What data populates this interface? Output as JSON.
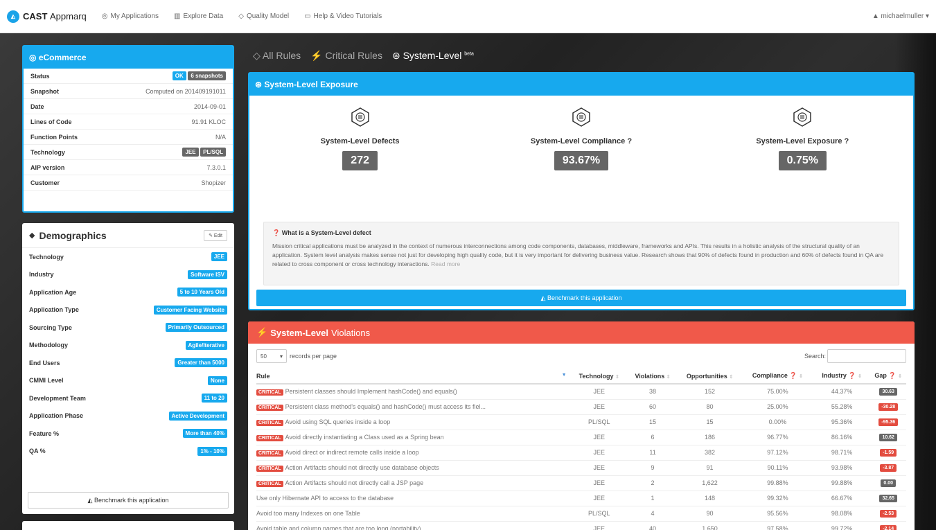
{
  "topbar": {
    "logo": "◭",
    "brand_bold": "CAST",
    "brand_rest": "Appmarq",
    "nav": [
      {
        "icon": "◎",
        "label": "My Applications"
      },
      {
        "icon": "▥",
        "label": "Explore Data"
      },
      {
        "icon": "◇",
        "label": "Quality Model"
      },
      {
        "icon": "▭",
        "label": "Help & Video Tutorials"
      }
    ],
    "user": "michaelmuller",
    "user_icon": "▲",
    "user_caret": "▾"
  },
  "app_panel": {
    "title": "eCommerce",
    "title_icon": "◎",
    "rows": [
      {
        "k": "Status"
      },
      {
        "k": "Snapshot",
        "v": "Computed on 201409191011"
      },
      {
        "k": "Date",
        "v": "2014-09-01"
      },
      {
        "k": "Lines of Code",
        "v": "91.91 KLOC"
      },
      {
        "k": "Function Points",
        "v": "N/A"
      },
      {
        "k": "Technology"
      },
      {
        "k": "AIP version",
        "v": "7.3.0.1"
      },
      {
        "k": "Customer",
        "v": "Shopizer"
      }
    ],
    "status_ok": "OK",
    "status_snapshots": "6 snapshots",
    "tech_badges": [
      "JEE",
      "PL/SQL"
    ]
  },
  "demographics": {
    "title": "Demographics",
    "title_icon": "◆",
    "edit_label": "✎ Edit",
    "rows": [
      {
        "k": "Technology",
        "v": "JEE"
      },
      {
        "k": "Industry",
        "v": "Software ISV"
      },
      {
        "k": "Application Age",
        "v": "5 to 10 Years Old"
      },
      {
        "k": "Application Type",
        "v": "Customer Facing Website"
      },
      {
        "k": "Sourcing Type",
        "v": "Primarily Outsourced"
      },
      {
        "k": "Methodology",
        "v": "Agile/Iterative"
      },
      {
        "k": "End Users",
        "v": "Greater than 5000"
      },
      {
        "k": "CMMI Level",
        "v": "None"
      },
      {
        "k": "Development Team",
        "v": "11 to 20"
      },
      {
        "k": "Application Phase",
        "v": "Active Development"
      },
      {
        "k": "Feature %",
        "v": "More than 40%"
      },
      {
        "k": "QA %",
        "v": "1% - 10%"
      }
    ],
    "benchmark_label": "Benchmark this application",
    "benchmark_icon": "◭"
  },
  "tabs": [
    {
      "icon": "◇",
      "label": "All Rules",
      "active": false
    },
    {
      "icon": "⚡",
      "label": "Critical Rules",
      "active": false
    },
    {
      "icon": "⊛",
      "label": "System-Level",
      "active": true,
      "sup": "beta"
    }
  ],
  "exposure": {
    "title": "System-Level Exposure",
    "title_icon": "⊛",
    "metrics": [
      {
        "label": "System-Level Defects",
        "value": "272",
        "help": ""
      },
      {
        "label": "System-Level Compliance",
        "value": "93.67%",
        "help": "?"
      },
      {
        "label": "System-Level Exposure",
        "value": "0.75%",
        "help": "?"
      }
    ],
    "info_title": "What is a System-Level defect",
    "info_body": "Mission critical applications must be analyzed in the context of numerous interconnections among code components, databases, middleware, frameworks and APIs. This results in a holistic analysis of the structural quality of an application. System level analysis makes sense not just for developing high quality code, but it is very important for delivering business value. Research shows that 90% of defects found in production and 60% of defects found in QA are related to cross component or cross technology interactions.",
    "read_more": "Read more",
    "benchmark_label": "Benchmark this application"
  },
  "violations": {
    "title_bold": "System-Level",
    "title_rest": "Violations",
    "title_icon": "⚡",
    "page_size": "50",
    "records_label": "records per page",
    "search_label": "Search:",
    "columns": [
      "Rule",
      "Technology",
      "Violations",
      "Opportunities",
      "Compliance ❓",
      "Industry ❓",
      "Gap ❓"
    ],
    "critical_label": "CRITICAL",
    "rows": [
      {
        "critical": true,
        "rule": "Persistent classes should Implement hashCode() and equals()",
        "tech": "JEE",
        "viol": "38",
        "opp": "152",
        "comp": "75.00%",
        "ind": "44.37%",
        "gap": "30.63",
        "neg": false
      },
      {
        "critical": true,
        "rule": "Persistent class method's equals() and hashCode() must access its fiel...",
        "tech": "JEE",
        "viol": "60",
        "opp": "80",
        "comp": "25.00%",
        "ind": "55.28%",
        "gap": "-30.28",
        "neg": true
      },
      {
        "critical": true,
        "rule": "Avoid using SQL queries inside a loop",
        "tech": "PL/SQL",
        "viol": "15",
        "opp": "15",
        "comp": "0.00%",
        "ind": "95.36%",
        "gap": "-95.36",
        "neg": true
      },
      {
        "critical": true,
        "rule": "Avoid directly instantiating a Class used as a Spring bean",
        "tech": "JEE",
        "viol": "6",
        "opp": "186",
        "comp": "96.77%",
        "ind": "86.16%",
        "gap": "10.62",
        "neg": false
      },
      {
        "critical": true,
        "rule": "Avoid direct or indirect remote calls inside a loop",
        "tech": "JEE",
        "viol": "11",
        "opp": "382",
        "comp": "97.12%",
        "ind": "98.71%",
        "gap": "-1.59",
        "neg": true
      },
      {
        "critical": true,
        "rule": "Action Artifacts should not directly use database objects",
        "tech": "JEE",
        "viol": "9",
        "opp": "91",
        "comp": "90.11%",
        "ind": "93.98%",
        "gap": "-3.87",
        "neg": true
      },
      {
        "critical": true,
        "rule": "Action Artifacts should not directly call a JSP page",
        "tech": "JEE",
        "viol": "2",
        "opp": "1,622",
        "comp": "99.88%",
        "ind": "99.88%",
        "gap": "0.00",
        "neg": false
      },
      {
        "critical": false,
        "rule": "Use only Hibernate API to access to the database",
        "tech": "JEE",
        "viol": "1",
        "opp": "148",
        "comp": "99.32%",
        "ind": "66.67%",
        "gap": "32.65",
        "neg": false
      },
      {
        "critical": false,
        "rule": "Avoid too many Indexes on one Table",
        "tech": "PL/SQL",
        "viol": "4",
        "opp": "90",
        "comp": "95.56%",
        "ind": "98.08%",
        "gap": "-2.53",
        "neg": true
      },
      {
        "critical": false,
        "rule": "Avoid table and column names that are too long (portability)",
        "tech": "JEE",
        "viol": "40",
        "opp": "1,650",
        "comp": "97.58%",
        "ind": "99.72%",
        "gap": "-2.14",
        "neg": true
      }
    ]
  },
  "colors": {
    "accent": "#17a9ee",
    "danger": "#f0594a",
    "critical": "#e34c3f",
    "neutral": "#666666"
  }
}
